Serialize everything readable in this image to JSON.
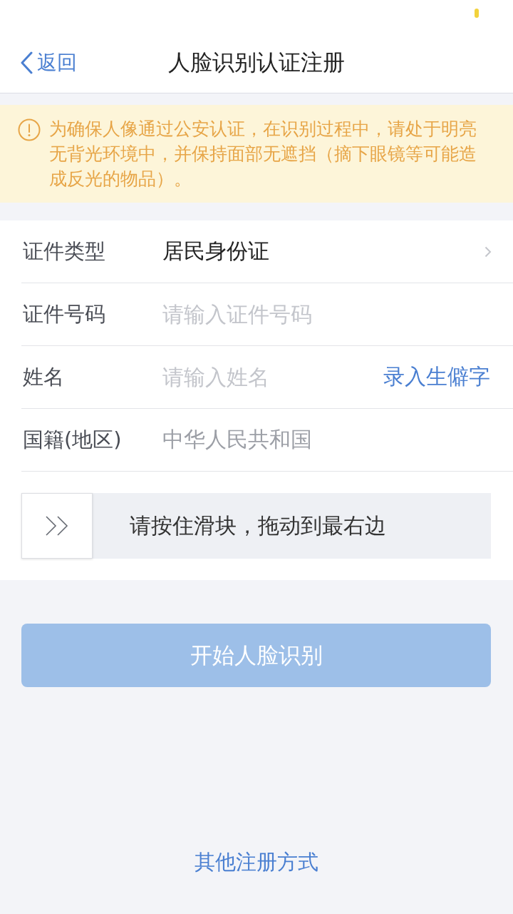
{
  "nav_bar": {
    "back_label": "返回",
    "title": "人脸识别认证注册"
  },
  "notice": {
    "text": "为确保人像通过公安认证，在识别过程中，请处于明亮无背光环境中，并保持面部无遮挡（摘下眼镜等可能造成反光的物品）。"
  },
  "form": {
    "rows": [
      {
        "kind": "select",
        "label": "证件类型",
        "value": "居民身份证"
      },
      {
        "kind": "input",
        "label": "证件号码",
        "placeholder": "请输入证件号码"
      },
      {
        "kind": "input",
        "label": "姓名",
        "placeholder": "请输入姓名",
        "action": "录入生僻字"
      },
      {
        "kind": "static",
        "label": "国籍(地区)",
        "value": "中华人民共和国"
      }
    ]
  },
  "slider": {
    "hint": "请按住滑块，拖动到最右边",
    "level": 0
  },
  "start_button": {
    "label": "开始人脸识别",
    "disabled": true
  },
  "other_link": "其他注册方式"
}
